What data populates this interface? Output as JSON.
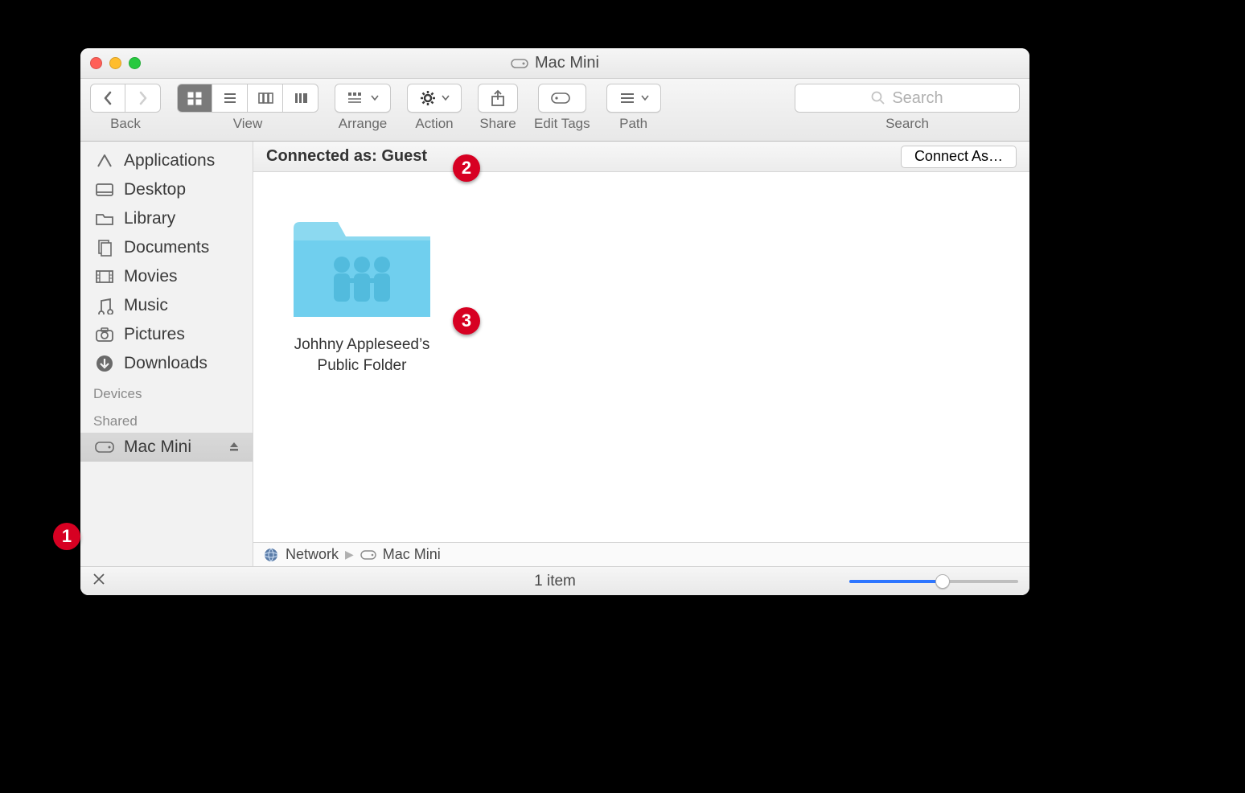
{
  "window": {
    "title": "Mac Mini"
  },
  "toolbar": {
    "back": "Back",
    "view": "View",
    "arrange": "Arrange",
    "action": "Action",
    "share": "Share",
    "edittags": "Edit Tags",
    "path": "Path",
    "search": "Search",
    "search_placeholder": "Search"
  },
  "sidebar": {
    "items": [
      "Applications",
      "Desktop",
      "Library",
      "Documents",
      "Movies",
      "Music",
      "Pictures",
      "Downloads"
    ],
    "devices_head": "Devices",
    "shared_head": "Shared",
    "shared_item": "Mac Mini"
  },
  "connbar": {
    "status": "Connected as: Guest",
    "button": "Connect As…"
  },
  "folder": {
    "name": "Johhny Appleseed’s Public Folder"
  },
  "pathbar": {
    "root": "Network",
    "leaf": "Mac Mini"
  },
  "statusbar": {
    "count": "1 item"
  },
  "callouts": {
    "c1": "1",
    "c2": "2",
    "c3": "3"
  }
}
